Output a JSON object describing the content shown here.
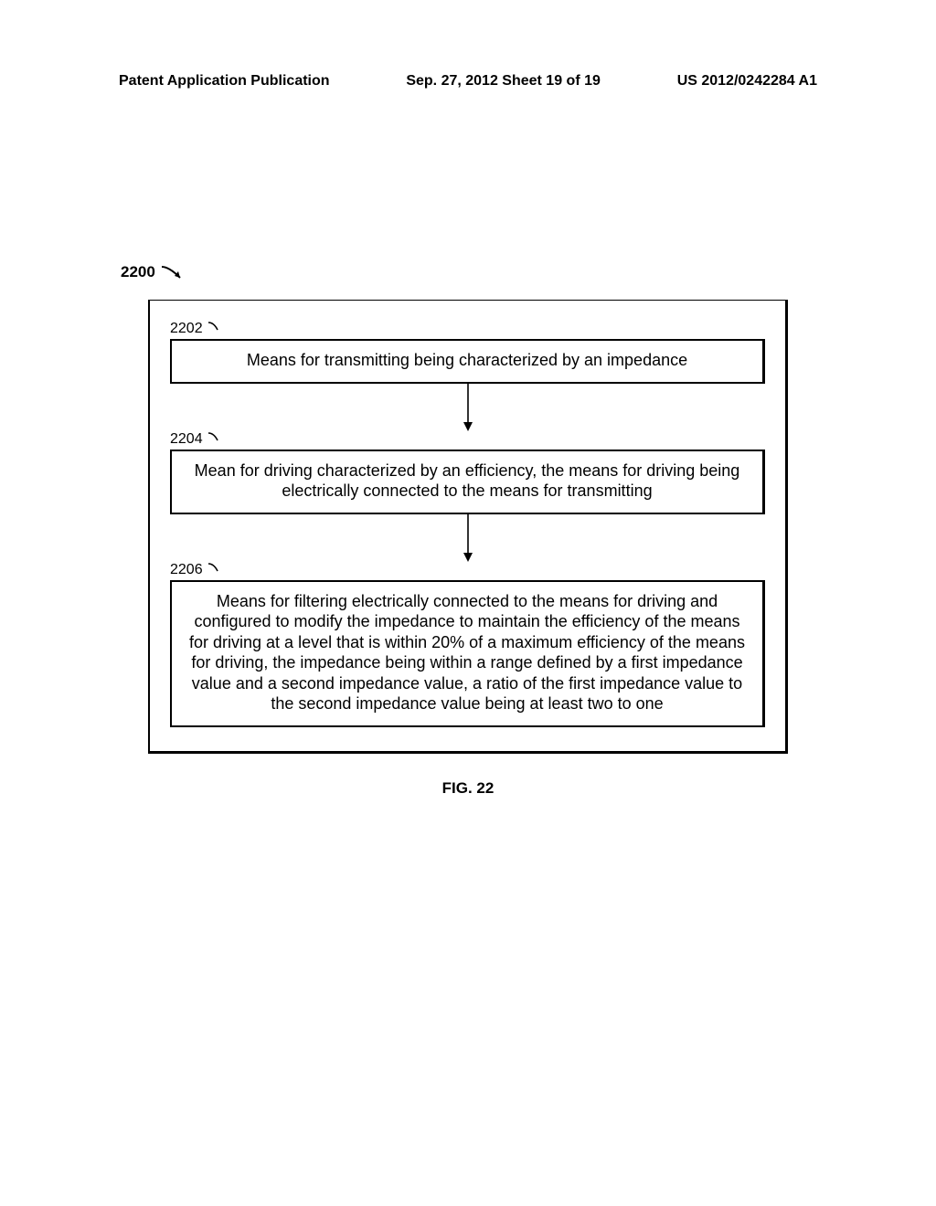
{
  "header": {
    "left": "Patent Application Publication",
    "center": "Sep. 27, 2012  Sheet 19 of 19",
    "right": "US 2012/0242284 A1"
  },
  "figure_ref": "2200",
  "blocks": [
    {
      "ref": "2202",
      "text": "Means for transmitting being characterized by an impedance"
    },
    {
      "ref": "2204",
      "text": "Mean for driving characterized by an efficiency, the means for driving being electrically connected to the means for transmitting"
    },
    {
      "ref": "2206",
      "text": "Means for filtering electrically connected to the means for driving and configured to modify the impedance to maintain the efficiency of the means for driving at a level that is within 20% of a maximum efficiency of the means for driving, the impedance being within a range defined by a first impedance value and a second impedance value, a ratio of the first impedance value to the second impedance value being at least two to one"
    }
  ],
  "caption": "FIG. 22"
}
